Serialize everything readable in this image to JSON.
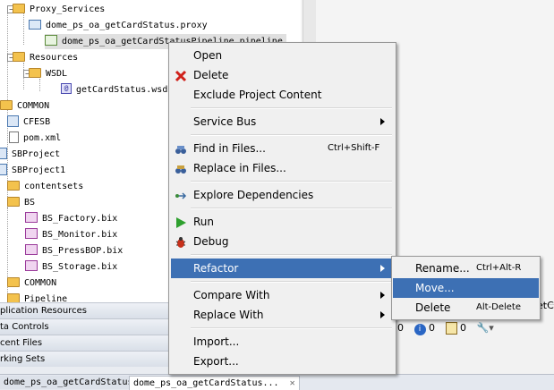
{
  "tree": {
    "items": [
      {
        "label": "Proxy_Services",
        "icon": "folder-icon"
      },
      {
        "label": "dome_ps_oa_getCardStatus.proxy",
        "icon": "proxy-icon"
      },
      {
        "label": "dome_ps_oa_getCardStatusPipeline.pipeline",
        "icon": "pipeline-icon"
      },
      {
        "label": "Resources",
        "icon": "folder-icon"
      },
      {
        "label": "WSDL",
        "icon": "folder-icon"
      },
      {
        "label": "getCardStatus.wsdl",
        "icon": "wsdl-icon"
      },
      {
        "label": "COMMON",
        "icon": "folder-icon"
      },
      {
        "label": "CFESB",
        "icon": "service-bus-project-icon"
      },
      {
        "label": "pom.xml",
        "icon": "xml-file-icon"
      },
      {
        "label": "SBProject",
        "icon": "service-bus-project-icon"
      },
      {
        "label": "SBProject1",
        "icon": "service-bus-project-icon"
      },
      {
        "label": "contentsets",
        "icon": "folder-icon"
      },
      {
        "label": "BS",
        "icon": "folder-icon"
      },
      {
        "label": "BS_Factory.bix",
        "icon": "business-service-icon"
      },
      {
        "label": "BS_Monitor.bix",
        "icon": "business-service-icon"
      },
      {
        "label": "BS_PressBOP.bix",
        "icon": "business-service-icon"
      },
      {
        "label": "BS_Storage.bix",
        "icon": "business-service-icon"
      },
      {
        "label": "COMMON",
        "icon": "folder-icon"
      },
      {
        "label": "Pipeline",
        "icon": "folder-icon"
      }
    ]
  },
  "panels": {
    "application_resources": "plication Resources",
    "data_controls": "ta Controls",
    "recent_files": "cent Files",
    "working_sets": "rking Sets"
  },
  "bottom_tabs": {
    "tab1": "dome_ps_oa_getCardStatusPi...",
    "tab2": "dome_ps_oa_getCardStatus..."
  },
  "right_panel": {
    "partial_text": "etC",
    "count_a": "0",
    "count_b": "0",
    "count_c": "0"
  },
  "context_menu": {
    "items": [
      {
        "label": "Open",
        "shortcut": "",
        "has_submenu": false
      },
      {
        "label": "Delete",
        "shortcut": "",
        "has_submenu": false
      },
      {
        "label": "Exclude Project Content",
        "shortcut": "",
        "has_submenu": false
      },
      {
        "label": "Service Bus",
        "shortcut": "",
        "has_submenu": true
      },
      {
        "label": "Find in Files...",
        "shortcut": "Ctrl+Shift-F",
        "has_submenu": false
      },
      {
        "label": "Replace in Files...",
        "shortcut": "",
        "has_submenu": false
      },
      {
        "label": "Explore Dependencies",
        "shortcut": "",
        "has_submenu": false
      },
      {
        "label": "Run",
        "shortcut": "",
        "has_submenu": false
      },
      {
        "label": "Debug",
        "shortcut": "",
        "has_submenu": false
      },
      {
        "label": "Refactor",
        "shortcut": "",
        "has_submenu": true
      },
      {
        "label": "Compare With",
        "shortcut": "",
        "has_submenu": true
      },
      {
        "label": "Replace With",
        "shortcut": "",
        "has_submenu": true
      },
      {
        "label": "Import...",
        "shortcut": "",
        "has_submenu": false
      },
      {
        "label": "Export...",
        "shortcut": "",
        "has_submenu": false
      }
    ]
  },
  "refactor_submenu": {
    "items": [
      {
        "label": "Rename...",
        "shortcut": "Ctrl+Alt-R"
      },
      {
        "label": "Move...",
        "shortcut": ""
      },
      {
        "label": "Delete",
        "shortcut": "Alt-Delete"
      }
    ]
  },
  "colors": {
    "highlight": "#3d70b4",
    "folder": "#f3c24d",
    "menu_bg": "#f0f0f0"
  }
}
